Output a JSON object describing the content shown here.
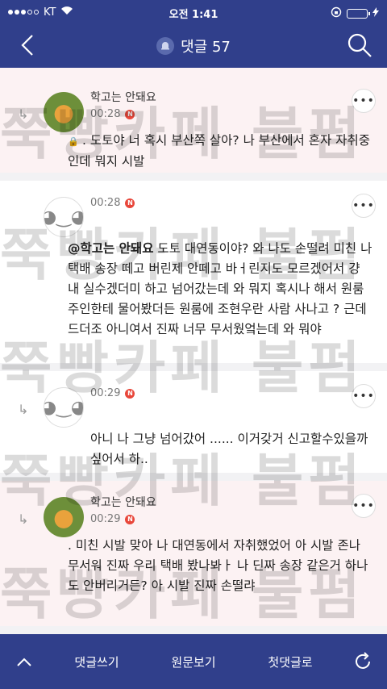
{
  "status_bar": {
    "carrier": "KT",
    "time": "오전 1:41"
  },
  "header": {
    "title": "댓글 57"
  },
  "comments": [
    {
      "author": "학고는 안돼요",
      "time": "00:28",
      "new": "N",
      "secret": "🔒",
      "body": ".  도토야 너 혹시 부산쪽 살아? 나 부산에서 혼자 자취중인데 뭐지 시발"
    },
    {
      "author": "",
      "time": "00:28",
      "new": "N",
      "mention": "@학고는 안돼요",
      "body": "  도토 대연동이야? 와 나도 손떨려 미친 나 택배 송장 떼고 버린제 안떼고 바ㅓ린지도 모르겠어서 걍 내 실수겠더미 하고 넘어갔는데 와 뭐지 혹시나 해서 원룸 주인한테 물어봤더든 원룸에 조현우란 사람 사나고 ? 근데 드더조 아니여서 진짜 너무 무서웠엌는데 와 뭐야"
    },
    {
      "author": "",
      "time": "00:29",
      "new": "N",
      "body": "아니 나 그냥 넘어갔어 ...... 이거갖거 신고할수있을까싶어서 하.."
    },
    {
      "author": "학고는 안돼요",
      "time": "00:29",
      "new": "N",
      "body": ".  미친 시발 맞아 나 대연동에서 자취했었어 아 시발 존나 무서워 진짜 우리 택배 봤나봐ㅏ 나 딘짜 송장 같은거 하나도 안버리거든? 아 시발 진짜 손떨랴"
    }
  ],
  "watermark": "쭉빵카페 불펌 금지",
  "bottom_bar": {
    "write": "댓글쓰기",
    "view_original": "원문보기",
    "first_comment": "첫댓글로"
  }
}
